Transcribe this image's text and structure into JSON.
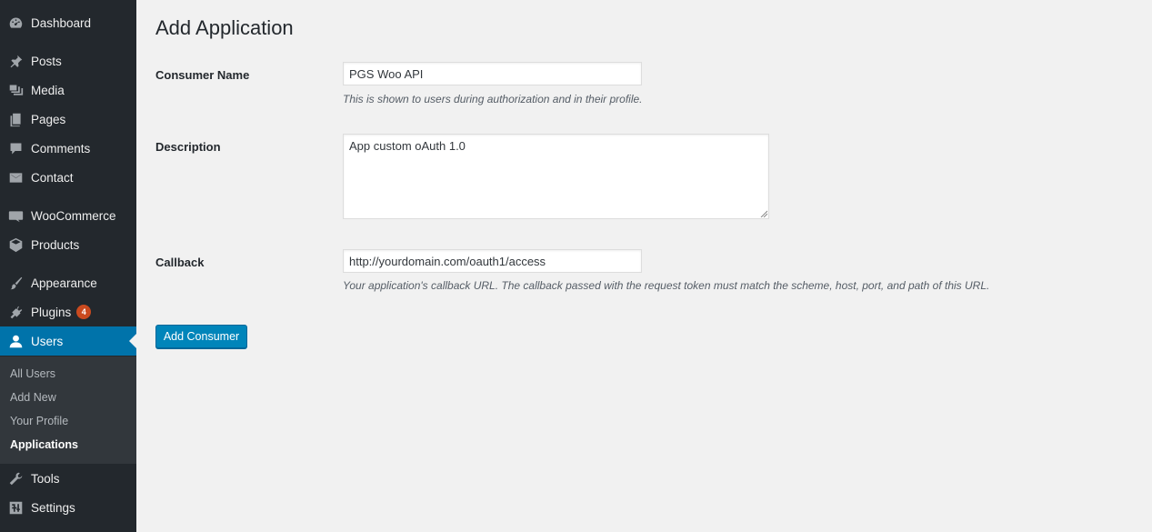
{
  "sidebar": {
    "items": [
      {
        "label": "Dashboard",
        "icon": "dashboard-icon"
      },
      {
        "label": "Posts",
        "icon": "pin-icon"
      },
      {
        "label": "Media",
        "icon": "media-icon"
      },
      {
        "label": "Pages",
        "icon": "pages-icon"
      },
      {
        "label": "Comments",
        "icon": "comment-icon"
      },
      {
        "label": "Contact",
        "icon": "envelope-icon"
      },
      {
        "label": "WooCommerce",
        "icon": "woo-icon"
      },
      {
        "label": "Products",
        "icon": "box-icon"
      },
      {
        "label": "Appearance",
        "icon": "brush-icon"
      },
      {
        "label": "Plugins",
        "icon": "plug-icon",
        "badge": "4"
      },
      {
        "label": "Users",
        "icon": "user-icon"
      },
      {
        "label": "Tools",
        "icon": "wrench-icon"
      },
      {
        "label": "Settings",
        "icon": "settings-icon"
      }
    ],
    "users_submenu": [
      {
        "label": "All Users"
      },
      {
        "label": "Add New"
      },
      {
        "label": "Your Profile"
      },
      {
        "label": "Applications"
      }
    ]
  },
  "page": {
    "title": "Add Application",
    "consumer_name": {
      "label": "Consumer Name",
      "value": "PGS Woo API",
      "help": "This is shown to users during authorization and in their profile."
    },
    "description": {
      "label": "Description",
      "value": "App custom oAuth 1.0"
    },
    "callback": {
      "label": "Callback",
      "value": "http://yourdomain.com/oauth1/access",
      "help": "Your application's callback URL. The callback passed with the request token must match the scheme, host, port, and path of this URL."
    },
    "submit_label": "Add Consumer"
  },
  "colors": {
    "sidebar_bg": "#23282d",
    "submenu_bg": "#32373c",
    "accent": "#0073aa",
    "button": "#0085ba",
    "badge": "#ca4a1f",
    "page_bg": "#f1f1f1"
  }
}
